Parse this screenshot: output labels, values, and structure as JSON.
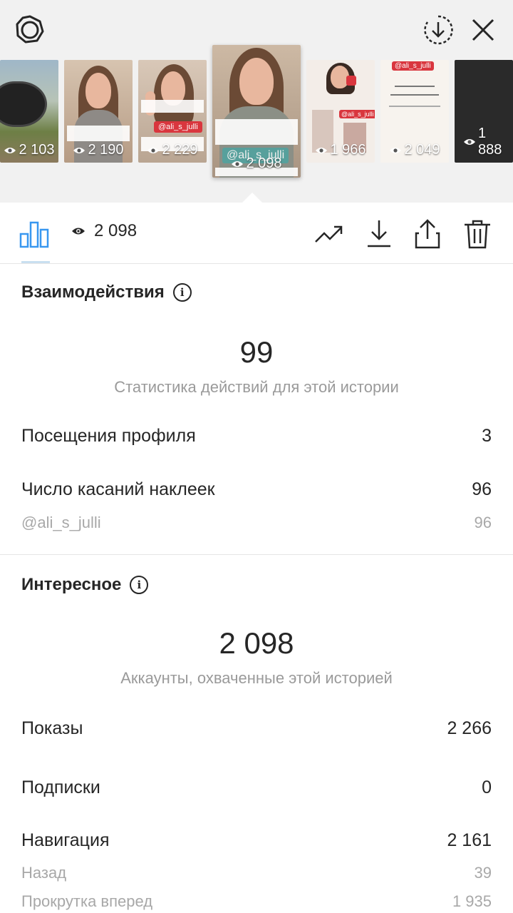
{
  "top": {
    "icons": [
      "settings-icon",
      "download-circle-icon",
      "close-icon"
    ]
  },
  "thumbnails": [
    {
      "views": "2 103"
    },
    {
      "views": "2 190"
    },
    {
      "views": "2 229",
      "tag": "@ali_s_julli"
    },
    {
      "views": "2 098",
      "tag": "@ali_s_julli",
      "selected": true
    },
    {
      "views": "1 966",
      "tag": "@ali_s_julli"
    },
    {
      "views": "2 049",
      "tag": "@ali_s_julli"
    },
    {
      "views": "1 888"
    }
  ],
  "toolbar": {
    "views": "2 098",
    "icons": [
      "bar-chart-icon",
      "eye-icon",
      "trending-icon",
      "download-icon",
      "share-icon",
      "trash-icon"
    ]
  },
  "interactions": {
    "title": "Взаимодействия",
    "total": "99",
    "caption": "Статистика действий для этой истории",
    "rows": [
      {
        "label": "Посещения профиля",
        "value": "3"
      },
      {
        "label": "Число касаний наклеек",
        "value": "96"
      }
    ],
    "sub_rows": [
      {
        "label": "@ali_s_julli",
        "value": "96"
      }
    ]
  },
  "discovery": {
    "title": "Интересное",
    "total": "2 098",
    "caption": "Аккаунты, охваченные этой историей",
    "rows": [
      {
        "label": "Показы",
        "value": "2 266"
      },
      {
        "label": "Подписки",
        "value": "0"
      },
      {
        "label": "Навигация",
        "value": "2 161"
      }
    ],
    "sub_rows": [
      {
        "label": "Назад",
        "value": "39"
      },
      {
        "label": "Прокрутка вперед",
        "value": "1 935"
      }
    ]
  },
  "colors": {
    "accent": "#3897f0",
    "text": "#262626",
    "muted": "#9a9a9a"
  }
}
